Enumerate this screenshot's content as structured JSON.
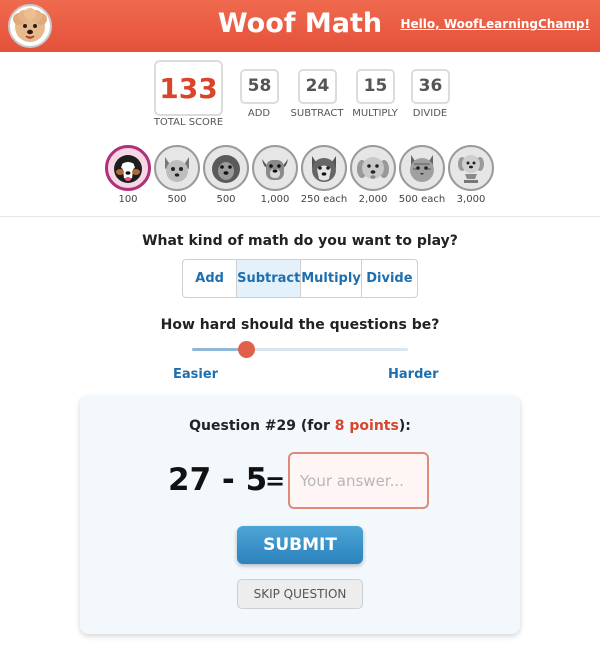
{
  "header": {
    "logo_icon": "poodle-avatar-icon",
    "title": "Woof Math",
    "greeting": "Hello, WoofLearningChamp!",
    "bg_color": "#e65a40"
  },
  "scoreboard": {
    "total": {
      "value": "133",
      "label": "TOTAL SCORE"
    },
    "stats": [
      {
        "value": "58",
        "label": "ADD"
      },
      {
        "value": "24",
        "label": "SUBTRACT"
      },
      {
        "value": "15",
        "label": "MULTIPLY"
      },
      {
        "value": "36",
        "label": "DIVIDE"
      }
    ]
  },
  "badges": [
    {
      "icon": "bernese-dog-badge-icon",
      "label": "100"
    },
    {
      "icon": "chihuahua-badge-icon",
      "label": "500"
    },
    {
      "icon": "shaggy-dog-badge-icon",
      "label": "500"
    },
    {
      "icon": "boxer-dog-badge-icon",
      "label": "1,000"
    },
    {
      "icon": "husky-badge-icon",
      "label": "250 each"
    },
    {
      "icon": "golden-retriever-badge-icon",
      "label": "2,000"
    },
    {
      "icon": "cat-badge-icon",
      "label": "500 each"
    },
    {
      "icon": "trophy-dog-badge-icon",
      "label": "3,000"
    }
  ],
  "operation": {
    "heading": "What kind of math do you want to play?",
    "options": [
      "Add",
      "Subtract",
      "Multiply",
      "Divide"
    ],
    "selected": "Subtract"
  },
  "difficulty": {
    "heading": "How hard should the questions be?",
    "min_label": "Easier",
    "max_label": "Harder",
    "level_fraction": 0.25
  },
  "question": {
    "prefix": "Question #29 (for ",
    "points": "8 points",
    "suffix": "):",
    "problem": "27 - 5",
    "equals": "=",
    "answer_placeholder": "Your answer...",
    "submit_label": "SUBMIT",
    "skip_label": "SKIP QUESTION"
  }
}
